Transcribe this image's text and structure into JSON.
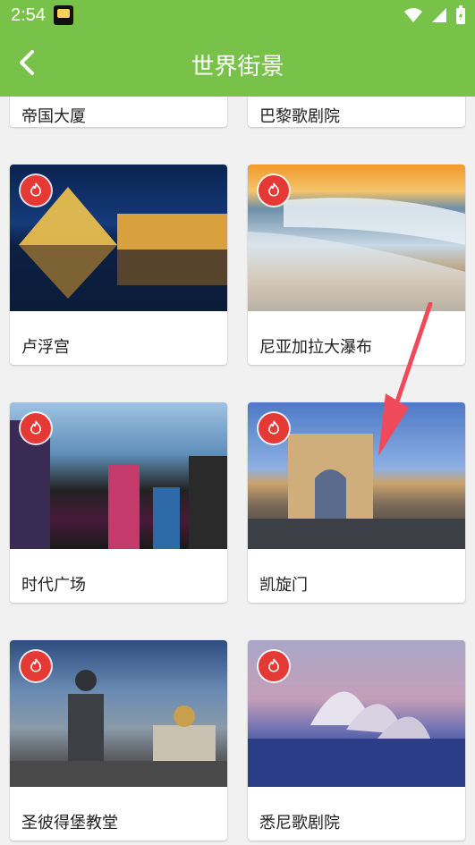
{
  "status_bar": {
    "time": "2:54"
  },
  "app_bar": {
    "title": "世界街景"
  },
  "cards": [
    {
      "caption": "帝国大厦"
    },
    {
      "caption": "巴黎歌剧院"
    },
    {
      "caption": "卢浮宫"
    },
    {
      "caption": "尼亚加拉大瀑布"
    },
    {
      "caption": "时代广场"
    },
    {
      "caption": "凯旋门"
    },
    {
      "caption": "圣彼得堡教堂"
    },
    {
      "caption": "悉尼歌剧院"
    }
  ],
  "colors": {
    "appbar": "#78c24a",
    "badge": "#e53935",
    "arrow": "#ef4a59"
  },
  "icons": {
    "back": "chevron-left-icon",
    "badge": "fire-icon",
    "wifi": "wifi-icon",
    "signal": "signal-icon",
    "battery": "battery-icon"
  }
}
